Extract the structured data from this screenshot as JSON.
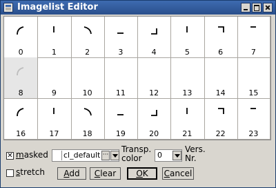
{
  "window": {
    "title": "Imagelist Editor",
    "title_bar_color": "#2f5797"
  },
  "images": {
    "selected": "8",
    "items": [
      {
        "label": "0",
        "glyph": "arc"
      },
      {
        "label": "1",
        "glyph": "vtick"
      },
      {
        "label": "2",
        "glyph": "arc-mirror"
      },
      {
        "label": "3",
        "glyph": "hline"
      },
      {
        "label": "4",
        "glyph": "corner-br"
      },
      {
        "label": "5",
        "glyph": "vtick"
      },
      {
        "label": "6",
        "glyph": "corner-tr"
      },
      {
        "label": "7",
        "glyph": "hline-top"
      },
      {
        "label": "8",
        "glyph": "arc-faint"
      },
      {
        "label": "9",
        "glyph": "none"
      },
      {
        "label": "10",
        "glyph": "none"
      },
      {
        "label": "11",
        "glyph": "none"
      },
      {
        "label": "12",
        "glyph": "none"
      },
      {
        "label": "13",
        "glyph": "none"
      },
      {
        "label": "14",
        "glyph": "none"
      },
      {
        "label": "15",
        "glyph": "none"
      },
      {
        "label": "16",
        "glyph": "arc"
      },
      {
        "label": "17",
        "glyph": "vtick"
      },
      {
        "label": "18",
        "glyph": "arc-mirror"
      },
      {
        "label": "19",
        "glyph": "hline"
      },
      {
        "label": "20",
        "glyph": "corner-br"
      },
      {
        "label": "21",
        "glyph": "vtick"
      },
      {
        "label": "22",
        "glyph": "corner-tr"
      },
      {
        "label": "23",
        "glyph": "hline-top"
      }
    ]
  },
  "controls": {
    "masked": {
      "label": "masked",
      "checked": true
    },
    "stretch": {
      "label": "stretch",
      "checked": false
    },
    "transp_color": {
      "value": "cl_default",
      "label_line1": "Transp.",
      "label_line2": "color"
    },
    "version": {
      "value": "0",
      "label_line1": "Vers.",
      "label_line2": "Nr."
    },
    "buttons": {
      "add": "Add",
      "clear": "Clear",
      "ok": "OK",
      "cancel": "Cancel"
    }
  }
}
